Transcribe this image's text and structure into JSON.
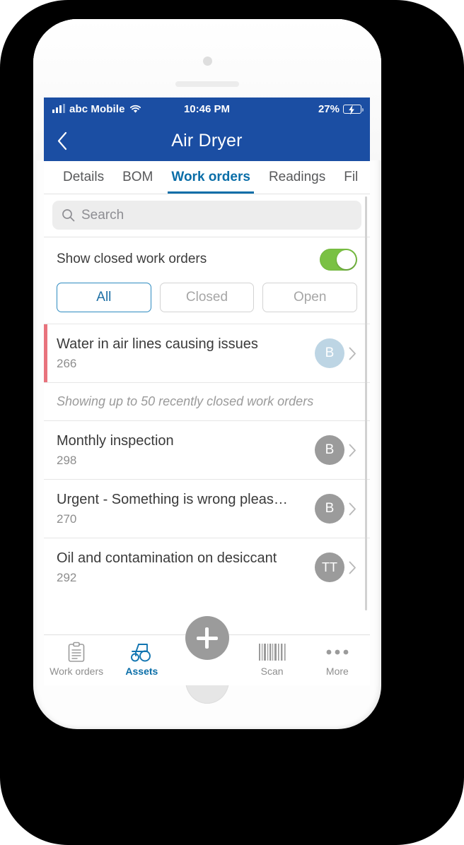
{
  "device": {
    "name": "white-smartphone",
    "camera": "camera-dot",
    "speaker": "speaker-grille",
    "home": "home-button"
  },
  "status_bar": {
    "carrier": "abc Mobile",
    "signal_icon": "signal-bars-icon",
    "wifi_icon": "wifi-icon",
    "time": "10:46 PM",
    "battery_percent": "27%",
    "battery_icon": "battery-charging-icon",
    "battery_fill_color": "#fcd116",
    "bar_color": "#1b4ea3"
  },
  "nav": {
    "back_icon": "back-chevron-icon",
    "title": "Air Dryer"
  },
  "tabs": {
    "items": [
      {
        "label": "Details",
        "active": false
      },
      {
        "label": "BOM",
        "active": false
      },
      {
        "label": "Work orders",
        "active": true
      },
      {
        "label": "Readings",
        "active": false
      },
      {
        "label": "Fil",
        "active": false
      }
    ],
    "active_color": "#0a6ea8"
  },
  "search": {
    "placeholder": "Search",
    "icon": "search-icon",
    "value": ""
  },
  "toggle": {
    "label": "Show closed work orders",
    "state": "on",
    "on_color": "#7ac143"
  },
  "filters": {
    "chips": [
      {
        "label": "All",
        "active": true
      },
      {
        "label": "Closed",
        "active": false
      },
      {
        "label": "Open",
        "active": false
      }
    ],
    "active_color": "#1d6fa5"
  },
  "note": {
    "text": "Showing up to 50 recently closed work orders"
  },
  "work_orders": [
    {
      "title": "Water in air lines causing issues",
      "id": "266",
      "avatar": "B",
      "avatar_color": "#bdd5e4",
      "accent": "#e8737d"
    },
    {
      "title": "Monthly inspection",
      "id": "298",
      "avatar": "B",
      "avatar_color": "#9b9b9b",
      "accent": ""
    },
    {
      "title": "Urgent - Something is wrong pleas…",
      "id": "270",
      "avatar": "B",
      "avatar_color": "#9b9b9b",
      "accent": ""
    },
    {
      "title": "Oil and contamination on desiccant",
      "id": "292",
      "avatar": "TT",
      "avatar_color": "#9b9b9b",
      "accent": ""
    }
  ],
  "bottom_nav": {
    "items": [
      {
        "label": "Work orders",
        "icon": "clipboard-icon",
        "active": false
      },
      {
        "label": "Assets",
        "icon": "tractor-icon",
        "active": true
      },
      {
        "label": "Scan",
        "icon": "barcode-icon",
        "active": false
      },
      {
        "label": "More",
        "icon": "ellipsis-icon",
        "active": false
      }
    ],
    "fab": {
      "icon": "plus-icon",
      "color": "#9b9b9b"
    },
    "active_color": "#0a6ea8"
  },
  "scrollbar": {
    "name": "vertical-scrollbar"
  }
}
